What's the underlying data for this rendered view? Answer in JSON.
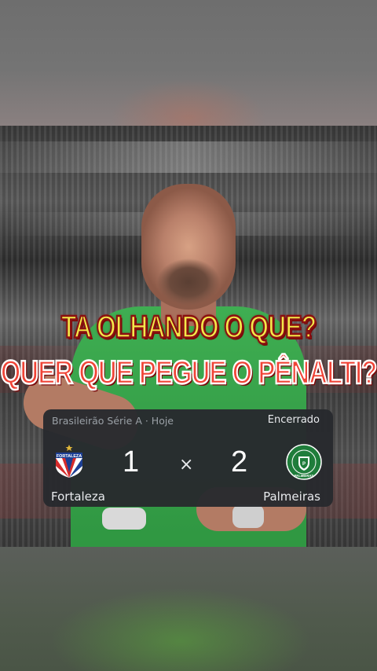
{
  "caption": {
    "line1": "TA OLHANDO O QUE?",
    "line2": "QUER QUE PEGUE O PÊNALTI?"
  },
  "match": {
    "league": "Brasileirão Série A · Hoje",
    "status": "Encerrado",
    "separator": "×",
    "home": {
      "name": "Fortaleza",
      "score": "1",
      "crest_text": "FORTALEZA"
    },
    "away": {
      "name": "Palmeiras",
      "score": "2",
      "crest_text": "PALMEIRAS"
    }
  },
  "colors": {
    "caption_line1": "#f3e94a",
    "caption_line2": "#f04336",
    "card_bg": "#28292e",
    "palmeiras_green": "#1f7d3b",
    "fortaleza_blue": "#1c3f94",
    "fortaleza_red": "#d62b2b"
  },
  "icons": {
    "home_crest": "fortaleza-crest-icon",
    "away_crest": "palmeiras-crest-icon"
  }
}
